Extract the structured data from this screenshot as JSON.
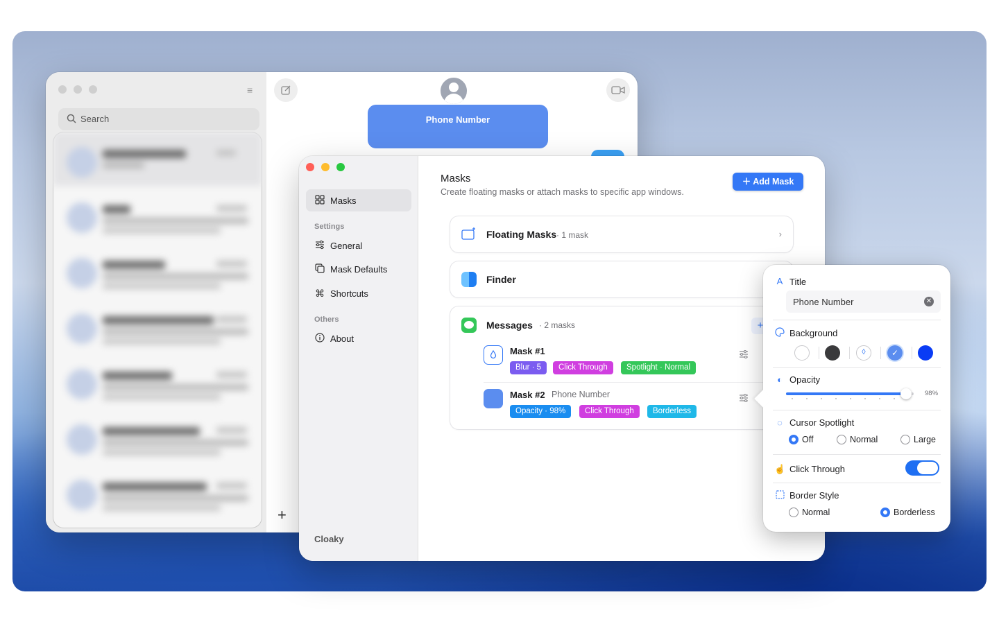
{
  "messages_window": {
    "search_placeholder": "Search",
    "mask_label": "Phone Number"
  },
  "app": {
    "name": "Cloaky",
    "sidebar": {
      "items": [
        {
          "label": "Masks",
          "icon": "grid-icon",
          "active": true
        },
        {
          "section": "Settings"
        },
        {
          "label": "General",
          "icon": "sliders-icon"
        },
        {
          "label": "Mask Defaults",
          "icon": "squares-icon"
        },
        {
          "label": "Shortcuts",
          "icon": "command-icon"
        },
        {
          "section": "Others"
        },
        {
          "label": "About",
          "icon": "info-icon"
        }
      ]
    },
    "header": {
      "title": "Masks",
      "subtitle": "Create floating masks or attach masks to specific app windows.",
      "add_button": "Add Mask"
    },
    "floating": {
      "title": "Floating Masks",
      "count": "· 1 mask"
    },
    "finder": {
      "title": "Finder"
    },
    "messages": {
      "title": "Messages",
      "count": "· 2 masks",
      "masks": [
        {
          "name": "Mask #1",
          "subtitle": "",
          "tags": [
            "Blur · 5",
            "Click Through",
            "Spotlight · Normal"
          ]
        },
        {
          "name": "Mask #2",
          "subtitle": "Phone Number",
          "tags": [
            "Opacity · 98%",
            "Click Through",
            "Borderless"
          ]
        }
      ]
    }
  },
  "popover": {
    "title_label": "Title",
    "title_value": "Phone Number",
    "background_label": "Background",
    "opacity_label": "Opacity",
    "opacity_value": "98%",
    "opacity_fraction": 0.98,
    "spotlight_label": "Cursor Spotlight",
    "spotlight_options": [
      "Off",
      "Normal",
      "Large"
    ],
    "spotlight_selected": "Off",
    "click_through_label": "Click Through",
    "click_through_on": true,
    "border_label": "Border Style",
    "border_options": [
      "Normal",
      "Borderless"
    ],
    "border_selected": "Borderless"
  },
  "colors": {
    "accent": "#3478f6",
    "mask_blue": "#5b8def",
    "tag_blur": "#7b5cf0",
    "tag_click": "#d03ee0",
    "tag_spotlight": "#34c759",
    "tag_opacity": "#1a8df0",
    "tag_border": "#1fb8e8"
  }
}
